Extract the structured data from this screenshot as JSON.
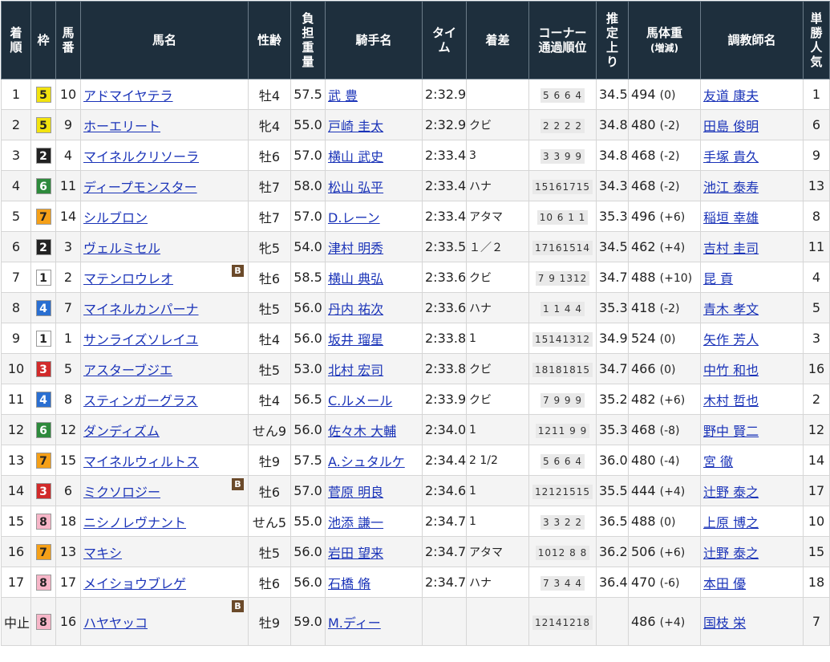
{
  "headers": {
    "rank": "着順",
    "waku": "枠",
    "umaban": "馬番",
    "horse": "馬名",
    "sexage": "性齢",
    "weight": "負担重量",
    "jockey": "騎手名",
    "time": "タイム",
    "margin": "着差",
    "corner": "コーナー通過順位",
    "last3f": "推定上り",
    "bodyweight": "馬体重",
    "bodyweight_sub": "(増減)",
    "trainer": "調教師名",
    "pop": "単勝人気"
  },
  "waku_colors": {
    "1": {
      "bg": "#ffffff",
      "fg": "#222222"
    },
    "2": {
      "bg": "#222222",
      "fg": "#ffffff"
    },
    "3": {
      "bg": "#d12a2a",
      "fg": "#ffffff"
    },
    "4": {
      "bg": "#2a6fd1",
      "fg": "#ffffff"
    },
    "5": {
      "bg": "#f2e30f",
      "fg": "#222222"
    },
    "6": {
      "bg": "#2e8a3c",
      "fg": "#ffffff"
    },
    "7": {
      "bg": "#f5a018",
      "fg": "#222222"
    },
    "8": {
      "bg": "#f7b6c8",
      "fg": "#222222"
    }
  },
  "rows": [
    {
      "rank": "1",
      "waku": "5",
      "umaban": "10",
      "horse": "アドマイヤテラ",
      "blinker": "",
      "sexage": "牡4",
      "weight": "57.5",
      "jockey": "武 豊",
      "time": "2:32.9",
      "margin": "",
      "corner": "5 6 6 4",
      "last3f": "34.5",
      "bw": "494",
      "bwc": "(0)",
      "trainer": "友道 康夫",
      "pop": "1"
    },
    {
      "rank": "2",
      "waku": "5",
      "umaban": "9",
      "horse": "ホーエリート",
      "blinker": "",
      "sexage": "牝4",
      "weight": "55.0",
      "jockey": "戸崎 圭太",
      "time": "2:32.9",
      "margin": "クビ",
      "corner": "2 2 2 2",
      "last3f": "34.8",
      "bw": "480",
      "bwc": "(-2)",
      "trainer": "田島 俊明",
      "pop": "6"
    },
    {
      "rank": "3",
      "waku": "2",
      "umaban": "4",
      "horse": "マイネルクリソーラ",
      "blinker": "",
      "sexage": "牡6",
      "weight": "57.0",
      "jockey": "横山 武史",
      "time": "2:33.4",
      "margin": "3",
      "corner": "3 3 9 9",
      "last3f": "34.8",
      "bw": "468",
      "bwc": "(-2)",
      "trainer": "手塚 貴久",
      "pop": "9"
    },
    {
      "rank": "4",
      "waku": "6",
      "umaban": "11",
      "horse": "ディープモンスター",
      "blinker": "",
      "sexage": "牡7",
      "weight": "58.0",
      "jockey": "松山 弘平",
      "time": "2:33.4",
      "margin": "ハナ",
      "corner": "15161715",
      "last3f": "34.3",
      "bw": "468",
      "bwc": "(-2)",
      "trainer": "池江 泰寿",
      "pop": "13"
    },
    {
      "rank": "5",
      "waku": "7",
      "umaban": "14",
      "horse": "シルブロン",
      "blinker": "",
      "sexage": "牡7",
      "weight": "57.0",
      "jockey": "D.レーン",
      "time": "2:33.4",
      "margin": "アタマ",
      "corner": "10 6 1 1",
      "last3f": "35.3",
      "bw": "496",
      "bwc": "(+6)",
      "trainer": "稲垣 幸雄",
      "pop": "8"
    },
    {
      "rank": "6",
      "waku": "2",
      "umaban": "3",
      "horse": "ヴェルミセル",
      "blinker": "",
      "sexage": "牝5",
      "weight": "54.0",
      "jockey": "津村 明秀",
      "time": "2:33.5",
      "margin": "１／２",
      "corner": "17161514",
      "last3f": "34.5",
      "bw": "462",
      "bwc": "(+4)",
      "trainer": "吉村 圭司",
      "pop": "11"
    },
    {
      "rank": "7",
      "waku": "1",
      "umaban": "2",
      "horse": "マテンロウレオ",
      "blinker": "B",
      "sexage": "牡6",
      "weight": "58.5",
      "jockey": "横山 典弘",
      "time": "2:33.6",
      "margin": "クビ",
      "corner": "7 9 1312",
      "last3f": "34.7",
      "bw": "488",
      "bwc": "(+10)",
      "trainer": "昆 貢",
      "pop": "4"
    },
    {
      "rank": "8",
      "waku": "4",
      "umaban": "7",
      "horse": "マイネルカンパーナ",
      "blinker": "",
      "sexage": "牡5",
      "weight": "56.0",
      "jockey": "丹内 祐次",
      "time": "2:33.6",
      "margin": "ハナ",
      "corner": "1 1 4 4",
      "last3f": "35.3",
      "bw": "418",
      "bwc": "(-2)",
      "trainer": "青木 孝文",
      "pop": "5"
    },
    {
      "rank": "9",
      "waku": "1",
      "umaban": "1",
      "horse": "サンライズソレイユ",
      "blinker": "",
      "sexage": "牡4",
      "weight": "56.0",
      "jockey": "坂井 瑠星",
      "time": "2:33.8",
      "margin": "1",
      "corner": "15141312",
      "last3f": "34.9",
      "bw": "524",
      "bwc": "(0)",
      "trainer": "矢作 芳人",
      "pop": "3"
    },
    {
      "rank": "10",
      "waku": "3",
      "umaban": "5",
      "horse": "アスターブジエ",
      "blinker": "",
      "sexage": "牡5",
      "weight": "53.0",
      "jockey": "北村 宏司",
      "time": "2:33.8",
      "margin": "クビ",
      "corner": "18181815",
      "last3f": "34.7",
      "bw": "466",
      "bwc": "(0)",
      "trainer": "中竹 和也",
      "pop": "16"
    },
    {
      "rank": "11",
      "waku": "4",
      "umaban": "8",
      "horse": "スティンガーグラス",
      "blinker": "",
      "sexage": "牡4",
      "weight": "56.5",
      "jockey": "C.ルメール",
      "time": "2:33.9",
      "margin": "クビ",
      "corner": "7 9 9 9",
      "last3f": "35.2",
      "bw": "482",
      "bwc": "(+6)",
      "trainer": "木村 哲也",
      "pop": "2"
    },
    {
      "rank": "12",
      "waku": "6",
      "umaban": "12",
      "horse": "ダンディズム",
      "blinker": "",
      "sexage": "せん9",
      "weight": "56.0",
      "jockey": "佐々木 大輔",
      "time": "2:34.0",
      "margin": "1",
      "corner": "1211 9 9",
      "last3f": "35.3",
      "bw": "468",
      "bwc": "(-8)",
      "trainer": "野中 賢二",
      "pop": "12"
    },
    {
      "rank": "13",
      "waku": "7",
      "umaban": "15",
      "horse": "マイネルウィルトス",
      "blinker": "",
      "sexage": "牡9",
      "weight": "57.5",
      "jockey": "A.シュタルケ",
      "time": "2:34.4",
      "margin": "2 1/2",
      "corner": "5 6 6 4",
      "last3f": "36.0",
      "bw": "480",
      "bwc": "(-4)",
      "trainer": "宮 徹",
      "pop": "14"
    },
    {
      "rank": "14",
      "waku": "3",
      "umaban": "6",
      "horse": "ミクソロジー",
      "blinker": "B",
      "sexage": "牡6",
      "weight": "57.0",
      "jockey": "菅原 明良",
      "time": "2:34.6",
      "margin": "1",
      "corner": "12121515",
      "last3f": "35.5",
      "bw": "444",
      "bwc": "(+4)",
      "trainer": "辻野 泰之",
      "pop": "17"
    },
    {
      "rank": "15",
      "waku": "8",
      "umaban": "18",
      "horse": "ニシノレヴナント",
      "blinker": "",
      "sexage": "せん5",
      "weight": "55.0",
      "jockey": "池添 謙一",
      "time": "2:34.7",
      "margin": "1",
      "corner": "3 3 2 2",
      "last3f": "36.5",
      "bw": "488",
      "bwc": "(0)",
      "trainer": "上原 博之",
      "pop": "10"
    },
    {
      "rank": "16",
      "waku": "7",
      "umaban": "13",
      "horse": "マキシ",
      "blinker": "",
      "sexage": "牡5",
      "weight": "56.0",
      "jockey": "岩田 望来",
      "time": "2:34.7",
      "margin": "アタマ",
      "corner": "1012 8 8",
      "last3f": "36.2",
      "bw": "506",
      "bwc": "(+6)",
      "trainer": "辻野 泰之",
      "pop": "15"
    },
    {
      "rank": "17",
      "waku": "8",
      "umaban": "17",
      "horse": "メイショウブレゲ",
      "blinker": "",
      "sexage": "牡6",
      "weight": "56.0",
      "jockey": "石橋 脩",
      "time": "2:34.7",
      "margin": "ハナ",
      "corner": "7 3 4 4",
      "last3f": "36.4",
      "bw": "470",
      "bwc": "(-6)",
      "trainer": "本田 優",
      "pop": "18"
    },
    {
      "rank": "中止",
      "waku": "8",
      "umaban": "16",
      "horse": "ハヤヤッコ",
      "blinker": "B",
      "sexage": "牡9",
      "weight": "59.0",
      "jockey": "M.ディー",
      "time": "",
      "margin": "",
      "corner": "12141218",
      "last3f": "",
      "bw": "486",
      "bwc": "(+4)",
      "trainer": "国枝 栄",
      "pop": "7"
    }
  ]
}
